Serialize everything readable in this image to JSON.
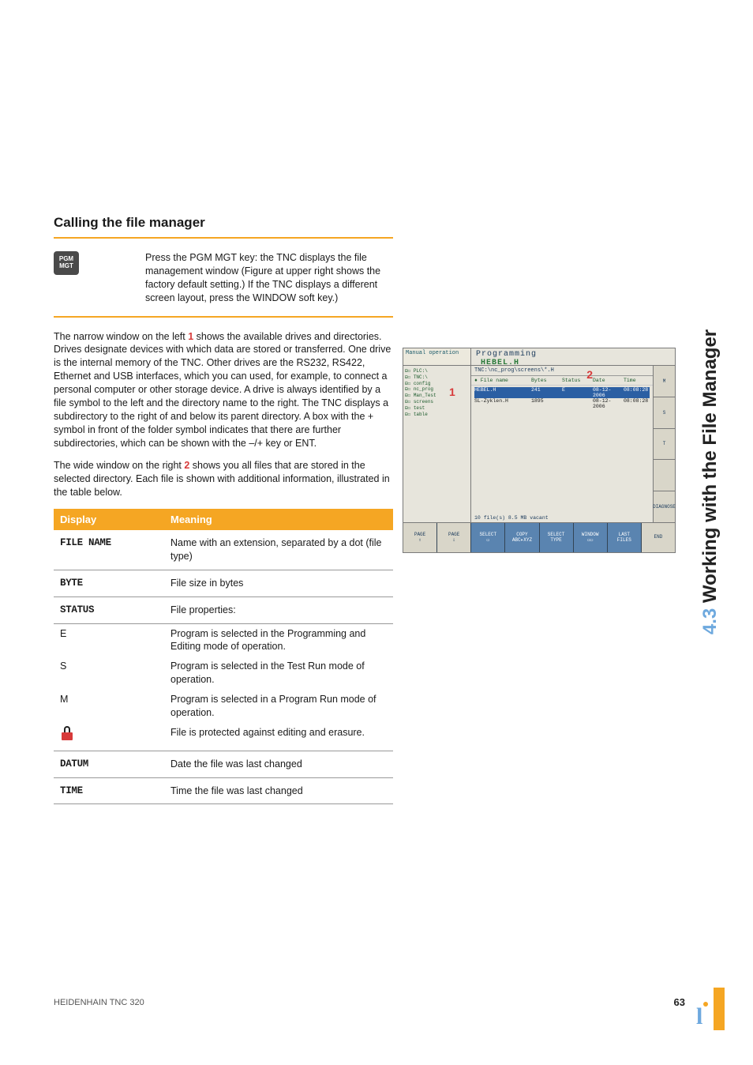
{
  "sideHeader": {
    "number": "4.3",
    "title": "Working with the File Manager"
  },
  "section": {
    "heading": "Calling the file manager",
    "keyIcon": {
      "line1": "PGM",
      "line2": "MGT"
    },
    "keyDesc": "Press the PGM MGT key: the TNC displays the file management window (Figure at upper right shows the factory default setting.) If the TNC displays a different screen layout, press the WINDOW soft key.)"
  },
  "para1": {
    "pre": "The narrow window on the left ",
    "num": "1",
    "post": " shows the available drives and directories. Drives designate devices with which data are stored or transferred. One drive is the internal memory of the TNC. Other drives are the RS232, RS422, Ethernet and USB interfaces, which you can used, for example, to connect a personal computer or other storage device. A drive is always identified by a file symbol to the left and the directory name to the right. The TNC displays a subdirectory to the right of and below its parent directory. A box with the + symbol in front of the folder symbol indicates that there are further subdirectories, which can be shown with the –/+ key or ENT."
  },
  "para2": {
    "pre": "The wide window on the right ",
    "num": "2",
    "post": " shows you all files that are stored in the selected directory. Each file is shown with additional information, illustrated in the table below."
  },
  "table": {
    "head": {
      "c1": "Display",
      "c2": "Meaning"
    },
    "rows": [
      {
        "c1": "FILE NAME",
        "c1mono": true,
        "c2": "Name with an extension, separated by a dot (file type)"
      },
      {
        "c1": "BYTE",
        "c1mono": true,
        "c2": "File size in bytes"
      },
      {
        "c1": "STATUS",
        "c1mono": true,
        "c2": "File properties:"
      }
    ],
    "statusRows": [
      {
        "c1": "E",
        "c2": "Program is selected in the Programming and Editing mode of operation."
      },
      {
        "c1": "S",
        "c2": "Program is selected in the Test Run mode of operation."
      },
      {
        "c1": "M",
        "c2": "Program is selected in a Program Run mode of operation."
      },
      {
        "c1": "__LOCK__",
        "c2": "File is protected against editing and erasure."
      }
    ],
    "tailRows": [
      {
        "c1": "DATUM",
        "c1mono": true,
        "c2": "Date the file was last changed"
      },
      {
        "c1": "TIME",
        "c1mono": true,
        "c2": "Time the file was last changed"
      }
    ]
  },
  "screenshot": {
    "mode": "Manual operation",
    "title": "Programming",
    "subtitle": "HEBEL.H",
    "path": "TNC:\\nc_prog\\screens\\*.H",
    "treeItems": [
      "⊟☐ PLC:\\",
      "⊟☐ TNC:\\",
      "  ⊟☐ config",
      "  ⊟☐ nc_prog",
      "    ⊟☐ Man_Test",
      "    ⊟☐ screens",
      "    ⊟☐ test",
      "  ⊟☐ table"
    ],
    "treeNum": "1",
    "fileNum": "2",
    "cols": [
      "♦ File name",
      "Bytes",
      "Status",
      "Date",
      "Time"
    ],
    "files": [
      {
        "name": "HEBEL.H",
        "bytes": "241",
        "status": "E",
        "date": "08-12-2006",
        "time": "08:08:28",
        "sel": true
      },
      {
        "name": "SL-Zyklen.H",
        "bytes": "1895",
        "status": "",
        "date": "08-12-2006",
        "time": "08:08:28",
        "sel": false
      }
    ],
    "status": "10  file(s)     8.5 MB vacant",
    "rightSlots": [
      "M",
      "S",
      "T",
      "",
      "DIAGNOSE"
    ],
    "softkeys": [
      "PAGE\n⇧",
      "PAGE\n⇩",
      "SELECT\n▭",
      "COPY\nABC▸XYZ",
      "SELECT\nTYPE",
      "WINDOW\n▭▭",
      "LAST\nFILES",
      "END"
    ]
  },
  "footer": {
    "left": "HEIDENHAIN TNC 320",
    "page": "63"
  }
}
